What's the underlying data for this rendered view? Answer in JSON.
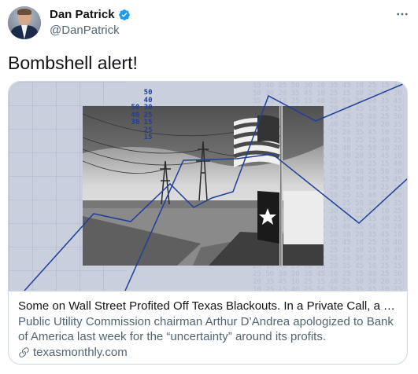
{
  "author": {
    "name": "Dan Patrick",
    "handle": "@DanPatrick"
  },
  "tweet": {
    "text": "Bombshell alert!"
  },
  "link_card": {
    "title": "Some on Wall Street Profited Off Texas Blackouts. In a Private Call, a Top Regulat...",
    "description": "Public Utility Commission chairman Arthur D’Andrea apologized to Bank of America last week for the “uncertainty” around its profits.",
    "domain": "texasmonthly.com",
    "image_numbers": "    50\n    40\n50 30\n40 25\n30 15\n25\n15"
  },
  "icons": {
    "verified": "verified-badge-icon",
    "more": "more-options-icon",
    "link": "link-icon"
  },
  "colors": {
    "verified": "#1d9bf0",
    "secondary_text": "#536471",
    "chart_line": "#1f3f9a"
  }
}
